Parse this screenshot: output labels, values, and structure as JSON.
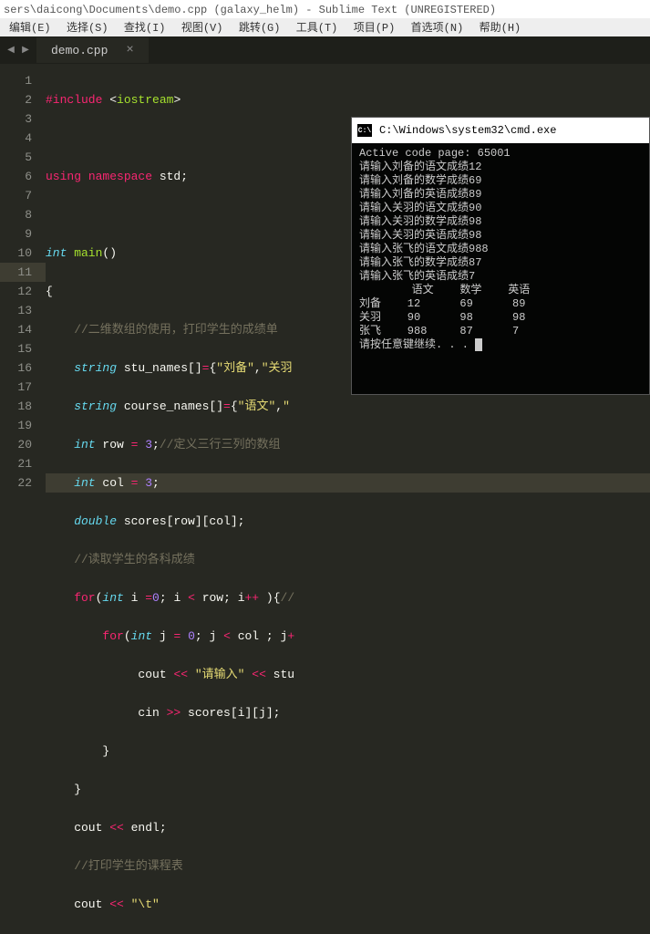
{
  "window": {
    "title": "sers\\daicong\\Documents\\demo.cpp (galaxy_helm) - Sublime Text (UNREGISTERED)"
  },
  "menu": {
    "items": [
      "编辑(E)",
      "选择(S)",
      "查找(I)",
      "视图(V)",
      "跳转(G)",
      "工具(T)",
      "项目(P)",
      "首选项(N)",
      "帮助(H)"
    ]
  },
  "tab": {
    "name": "demo.cpp",
    "dirty_marker": "×"
  },
  "nav": {
    "left": "◀",
    "right": "▶"
  },
  "gutter": {
    "lines": [
      "1",
      "2",
      "3",
      "4",
      "5",
      "6",
      "7",
      "8",
      "9",
      "10",
      "11",
      "12",
      "13",
      "14",
      "15",
      "16",
      "17",
      "18",
      "19",
      "20",
      "21",
      "22"
    ],
    "active": 11
  },
  "code": {
    "l1_kw1": "#include",
    "l1_lt": " <",
    "l1_fn": "iostream",
    "l1_gt": ">",
    "l3_kw": "using",
    "l3_kw2": " namespace",
    "l3_id": " std;",
    "l5_ty": "int",
    "l5_fn": " main",
    "l5_p": "()",
    "l6": "{",
    "l7_cm": "    //二维数组的使用，打印学生的成绩单",
    "l8_ty": "    string",
    "l8_id": " stu_names[]",
    "l8_op": "=",
    "l8_b": "{",
    "l8_s1": "\"刘备\"",
    "l8_c": ",",
    "l8_s2": "\"关羽",
    "l8_r": "",
    "l9_ty": "    string",
    "l9_id": " course_names[]",
    "l9_op": "=",
    "l9_b": "{",
    "l9_s1": "\"语文\"",
    "l9_c": ",",
    "l9_s2": "\"",
    "l10_ty": "    int",
    "l10_id": " row ",
    "l10_op": "=",
    "l10_n": " 3",
    "l10_sc": ";",
    "l10_cm": "//定义三行三列的数组",
    "l11_ty": "    int",
    "l11_id": " col ",
    "l11_op": "=",
    "l11_n": " 3",
    "l11_sc": ";",
    "l12_ty": "    double",
    "l12_id": " scores[row][col];",
    "l13_cm": "    //读取学生的各科成绩",
    "l14_kw": "    for",
    "l14_p": "(",
    "l14_ty": "int",
    "l14_id": " i ",
    "l14_op1": "=",
    "l14_n1": "0",
    "l14_sc": "; i ",
    "l14_op2": "<",
    "l14_id2": " row; i",
    "l14_op3": "++",
    "l14_p2": " ){",
    "l14_cm": "//",
    "l15_kw": "        for",
    "l15_p": "(",
    "l15_ty": "int",
    "l15_id": " j ",
    "l15_op1": "=",
    "l15_n1": " 0",
    "l15_sc": "; j ",
    "l15_op2": "<",
    "l15_id2": " col ; j",
    "l15_op3": "+",
    "l16_id": "             cout ",
    "l16_op": "<<",
    "l16_s": " \"请输入\" ",
    "l16_op2": "<<",
    "l16_id2": " stu",
    "l17_id": "             cin ",
    "l17_op": ">>",
    "l17_id2": " scores[i][j];",
    "l18": "        }",
    "l19": "    }",
    "l20_id": "    cout ",
    "l20_op": "<<",
    "l20_id2": " endl;",
    "l21_cm": "    //打印学生的课程表",
    "l22_id": "    cout ",
    "l22_op": "<<",
    "l22_s": " \"\\t\""
  },
  "terminal": {
    "title": "C:\\Windows\\system32\\cmd.exe",
    "icon_text": "C:\\",
    "lines": [
      "Active code page: 65001",
      "请输入刘备的语文成绩12",
      "请输入刘备的数学成绩69",
      "请输入刘备的英语成绩89",
      "请输入关羽的语文成绩90",
      "请输入关羽的数学成绩98",
      "请输入关羽的英语成绩98",
      "请输入张飞的语文成绩988",
      "请输入张飞的数学成绩87",
      "请输入张飞的英语成绩7",
      "",
      "        语文    数学    英语",
      "刘备    12      69      89",
      "关羽    90      98      98",
      "张飞    988     87      7",
      "",
      "请按任意键继续. . . "
    ]
  }
}
